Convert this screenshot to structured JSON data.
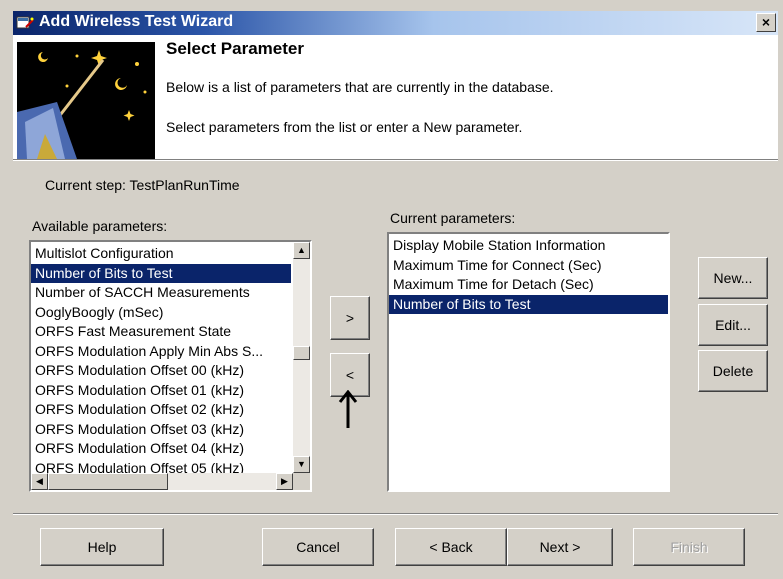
{
  "window": {
    "title": "Add Wireless Test Wizard",
    "close_glyph": "×"
  },
  "header": {
    "title": "Select Parameter",
    "line1": "Below is a list of parameters that are currently in the database.",
    "line2": "Select parameters from the list or enter a New parameter."
  },
  "current_step": "Current step: TestPlanRunTime",
  "available": {
    "label": "Available parameters:",
    "items": [
      "Multislot Configuration",
      "Number of Bits to Test",
      "Number of SACCH Measurements",
      "OoglyBoogly (mSec)",
      "ORFS Fast Measurement State",
      "ORFS Modulation Apply Min Abs S...",
      "ORFS Modulation Offset 00 (kHz)",
      "ORFS Modulation Offset 01 (kHz)",
      "ORFS Modulation Offset 02 (kHz)",
      "ORFS Modulation Offset 03 (kHz)",
      "ORFS Modulation Offset 04 (kHz)",
      "ORFS Modulation Offset 05 (kHz)"
    ],
    "selected": "Number of Bits to Test"
  },
  "current": {
    "label": "Current parameters:",
    "items": [
      "Display Mobile Station Information",
      "Maximum Time for Connect (Sec)",
      "Maximum Time for Detach (Sec)",
      "Number of Bits to Test"
    ],
    "selected": "Number of Bits to Test"
  },
  "move": {
    "add_label": ">",
    "remove_label": "<"
  },
  "side_buttons": {
    "new": "New...",
    "edit": "Edit...",
    "delete": "Delete"
  },
  "footer": {
    "help": "Help",
    "cancel": "Cancel",
    "back": "< Back",
    "next": "Next >",
    "finish": "Finish"
  },
  "scroll_glyphs": {
    "up": "▲",
    "down": "▼",
    "left": "◀",
    "right": "▶"
  },
  "icons": {
    "wizard_image": "wizard-wand-icon",
    "annotation": "up-arrow-icon",
    "title_icon": "wizard-app-icon"
  }
}
